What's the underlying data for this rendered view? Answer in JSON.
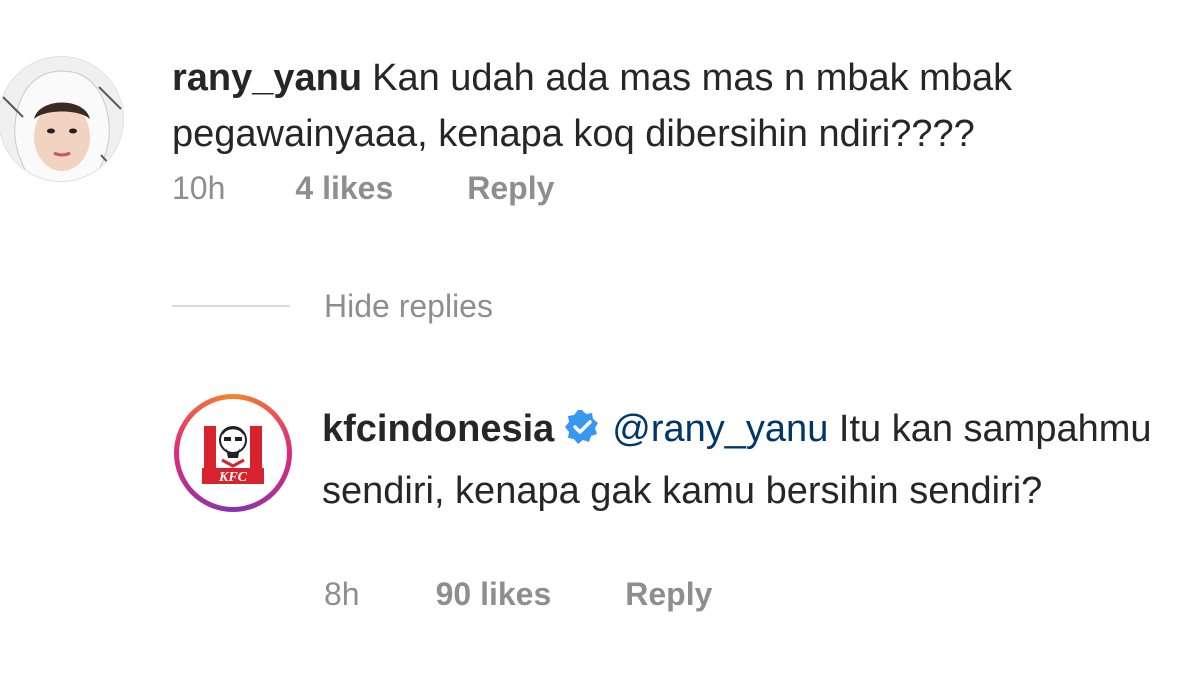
{
  "comment": {
    "username": "rany_yanu",
    "text": "Kan udah ada mas mas n mbak mbak pegawainyaaa, kenapa koq dibersihin ndiri????",
    "time": "10h",
    "likes": "4 likes",
    "reply_label": "Reply"
  },
  "thread": {
    "hide_replies_label": "Hide replies"
  },
  "reply": {
    "username": "kfcindonesia",
    "mention": "@rany_yanu",
    "text": "Itu kan sampahmu sendiri, kenapa gak kamu bersihin sendiri?",
    "time": "8h",
    "likes": "90 likes",
    "reply_label": "Reply",
    "avatar_logo_text": "KFC"
  },
  "icons": {
    "verified": "verified-badge-icon"
  },
  "colors": {
    "text": "#262626",
    "secondary": "#8e8e8e",
    "verified": "#3897f0",
    "mention": "#00376b",
    "kfc_red": "#d6232e",
    "story_ring_start": "#f58529",
    "story_ring_end": "#dd2a7b"
  }
}
